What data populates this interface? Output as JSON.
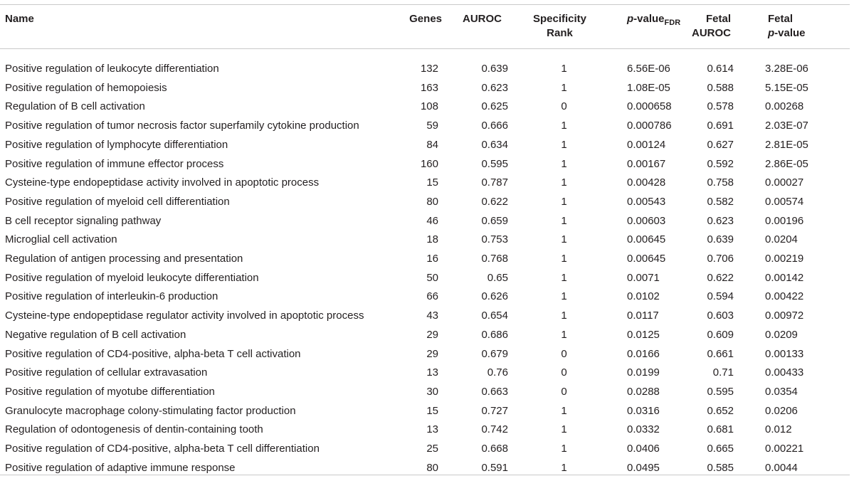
{
  "headers": {
    "name": "Name",
    "genes": "Genes",
    "auroc": "AUROC",
    "specificity_line1": "Specificity",
    "specificity_line2": "Rank",
    "pvalue_italic": "p",
    "pvalue_rest": "-value",
    "pvalue_sub": "FDR",
    "fetal_auroc_line1": "Fetal",
    "fetal_auroc_line2": "AUROC",
    "fetal_p_line1": "Fetal",
    "fetal_p_italic": "p",
    "fetal_p_rest": "-value"
  },
  "rows": [
    {
      "name": "Positive regulation of leukocyte differentiation",
      "genes": "132",
      "auroc": "0.639",
      "spec": "1",
      "pval": "6.56E-06",
      "fauroc": "0.614",
      "fp": "3.28E-06"
    },
    {
      "name": "Positive regulation of hemopoiesis",
      "genes": "163",
      "auroc": "0.623",
      "spec": "1",
      "pval": "1.08E-05",
      "fauroc": "0.588",
      "fp": "5.15E-05"
    },
    {
      "name": "Regulation of B cell activation",
      "genes": "108",
      "auroc": "0.625",
      "spec": "0",
      "pval": "0.000658",
      "fauroc": "0.578",
      "fp": "0.00268"
    },
    {
      "name": "Positive regulation of tumor necrosis factor superfamily cytokine production",
      "genes": "59",
      "auroc": "0.666",
      "spec": "1",
      "pval": "0.000786",
      "fauroc": "0.691",
      "fp": "2.03E-07"
    },
    {
      "name": "Positive regulation of lymphocyte differentiation",
      "genes": "84",
      "auroc": "0.634",
      "spec": "1",
      "pval": "0.00124",
      "fauroc": "0.627",
      "fp": "2.81E-05"
    },
    {
      "name": "Positive regulation of immune effector process",
      "genes": "160",
      "auroc": "0.595",
      "spec": "1",
      "pval": "0.00167",
      "fauroc": "0.592",
      "fp": "2.86E-05"
    },
    {
      "name": "Cysteine-type endopeptidase activity involved in apoptotic process",
      "genes": "15",
      "auroc": "0.787",
      "spec": "1",
      "pval": "0.00428",
      "fauroc": "0.758",
      "fp": "0.00027"
    },
    {
      "name": "Positive regulation of myeloid cell differentiation",
      "genes": "80",
      "auroc": "0.622",
      "spec": "1",
      "pval": "0.00543",
      "fauroc": "0.582",
      "fp": "0.00574"
    },
    {
      "name": "B cell receptor signaling pathway",
      "genes": "46",
      "auroc": "0.659",
      "spec": "1",
      "pval": "0.00603",
      "fauroc": "0.623",
      "fp": "0.00196"
    },
    {
      "name": "Microglial cell activation",
      "genes": "18",
      "auroc": "0.753",
      "spec": "1",
      "pval": "0.00645",
      "fauroc": "0.639",
      "fp": "0.0204"
    },
    {
      "name": "Regulation of antigen processing and presentation",
      "genes": "16",
      "auroc": "0.768",
      "spec": "1",
      "pval": "0.00645",
      "fauroc": "0.706",
      "fp": "0.00219"
    },
    {
      "name": "Positive regulation of myeloid leukocyte differentiation",
      "genes": "50",
      "auroc": "0.65",
      "spec": "1",
      "pval": "0.0071",
      "fauroc": "0.622",
      "fp": "0.00142"
    },
    {
      "name": "Positive regulation of interleukin-6 production",
      "genes": "66",
      "auroc": "0.626",
      "spec": "1",
      "pval": "0.0102",
      "fauroc": "0.594",
      "fp": "0.00422"
    },
    {
      "name": "Cysteine-type endopeptidase regulator activity involved in apoptotic process",
      "genes": "43",
      "auroc": "0.654",
      "spec": "1",
      "pval": "0.0117",
      "fauroc": "0.603",
      "fp": "0.00972"
    },
    {
      "name": "Negative regulation of B cell activation",
      "genes": "29",
      "auroc": "0.686",
      "spec": "1",
      "pval": "0.0125",
      "fauroc": "0.609",
      "fp": "0.0209"
    },
    {
      "name": "Positive regulation of CD4-positive, alpha-beta T cell activation",
      "genes": "29",
      "auroc": "0.679",
      "spec": "0",
      "pval": "0.0166",
      "fauroc": "0.661",
      "fp": "0.00133"
    },
    {
      "name": "Positive regulation of cellular extravasation",
      "genes": "13",
      "auroc": "0.76",
      "spec": "0",
      "pval": "0.0199",
      "fauroc": "0.71",
      "fp": "0.00433"
    },
    {
      "name": "Positive regulation of myotube differentiation",
      "genes": "30",
      "auroc": "0.663",
      "spec": "0",
      "pval": "0.0288",
      "fauroc": "0.595",
      "fp": "0.0354"
    },
    {
      "name": "Granulocyte macrophage colony-stimulating factor production",
      "genes": "15",
      "auroc": "0.727",
      "spec": "1",
      "pval": "0.0316",
      "fauroc": "0.652",
      "fp": "0.0206"
    },
    {
      "name": "Regulation of odontogenesis of dentin-containing tooth",
      "genes": "13",
      "auroc": "0.742",
      "spec": "1",
      "pval": "0.0332",
      "fauroc": "0.681",
      "fp": "0.012"
    },
    {
      "name": "Positive regulation of CD4-positive, alpha-beta T cell differentiation",
      "genes": "25",
      "auroc": "0.668",
      "spec": "1",
      "pval": "0.0406",
      "fauroc": "0.665",
      "fp": "0.00221"
    },
    {
      "name": "Positive regulation of adaptive immune response",
      "genes": "80",
      "auroc": "0.591",
      "spec": "1",
      "pval": "0.0495",
      "fauroc": "0.585",
      "fp": "0.0044"
    }
  ]
}
